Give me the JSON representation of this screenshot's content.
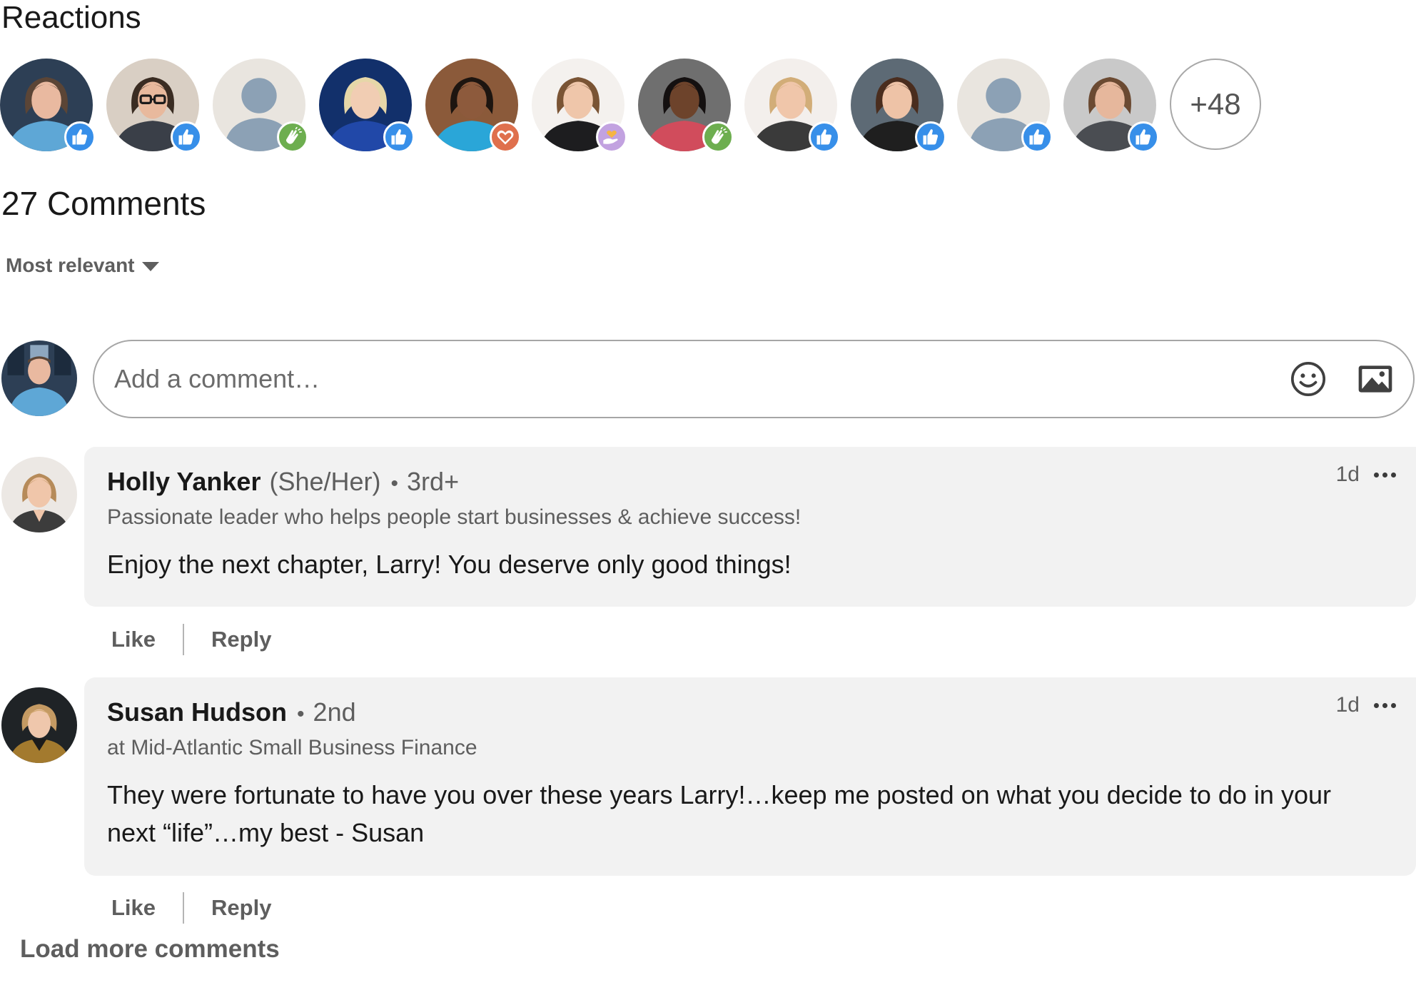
{
  "reactions": {
    "title": "Reactions",
    "avatars": [
      {
        "reaction": "like"
      },
      {
        "reaction": "like"
      },
      {
        "reaction": "clap"
      },
      {
        "reaction": "like"
      },
      {
        "reaction": "love"
      },
      {
        "reaction": "support"
      },
      {
        "reaction": "clap"
      },
      {
        "reaction": "like"
      },
      {
        "reaction": "like"
      },
      {
        "reaction": "like"
      },
      {
        "reaction": "like"
      }
    ],
    "more_label": "+48"
  },
  "comments_header": {
    "count_label": "27 Comments",
    "sort_label": "Most relevant"
  },
  "composer": {
    "placeholder": "Add a comment…"
  },
  "comments": [
    {
      "name": "Holly Yanker",
      "pronouns": "(She/Her)",
      "degree": "3rd+",
      "headline": "Passionate leader who helps people start businesses & achieve success!",
      "time": "1d",
      "text": "Enjoy the next chapter, Larry! You deserve only good things!",
      "like_label": "Like",
      "reply_label": "Reply"
    },
    {
      "name": "Susan Hudson",
      "degree": "2nd",
      "headline": "at Mid-Atlantic Small Business Finance",
      "time": "1d",
      "text": "They were fortunate to have you over these years Larry!…keep me posted on what you decide to do in your next “life”…my best - Susan",
      "like_label": "Like",
      "reply_label": "Reply"
    }
  ],
  "load_more_label": "Load more comments",
  "colors": {
    "like": "#378fe9",
    "clap": "#6dae4f",
    "love": "#df704d",
    "support": "#c2a2e0",
    "bubble": "#f2f2f2",
    "muted_text": "#5e5e5e"
  }
}
